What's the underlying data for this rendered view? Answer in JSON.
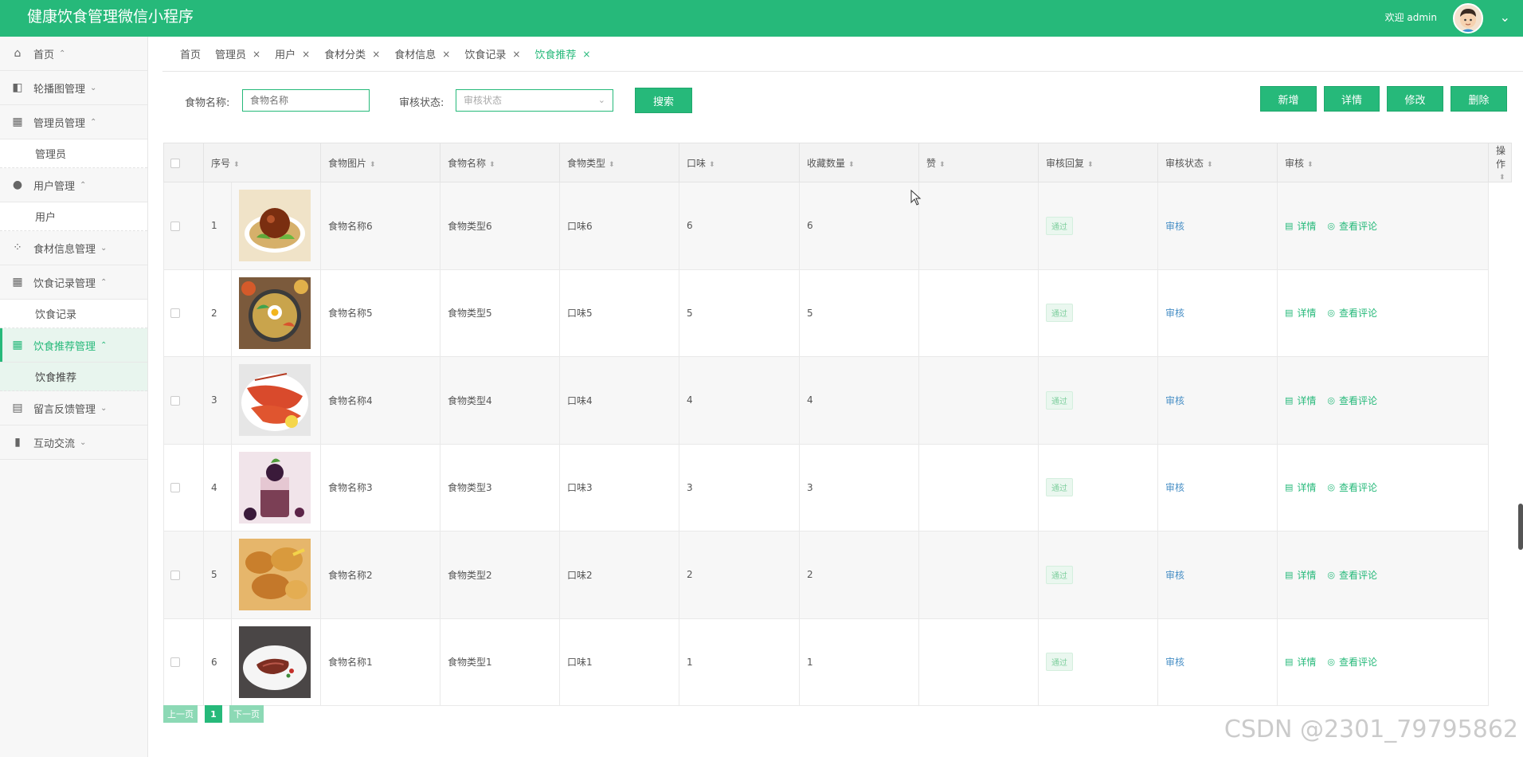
{
  "app": {
    "title": "健康饮食管理微信小程序",
    "welcome": "欢迎 admin",
    "accent": "#26b97a"
  },
  "sidebar": {
    "items": [
      {
        "label": "首页",
        "icon": "home-icon",
        "glyph": "⌂",
        "arrow": "⌃",
        "sub": []
      },
      {
        "label": "轮播图管理",
        "icon": "carousel-icon",
        "glyph": "◧",
        "arrow": "⌄",
        "sub": []
      },
      {
        "label": "管理员管理",
        "icon": "admin-icon",
        "glyph": "▦",
        "arrow": "⌃",
        "sub": [
          "管理员"
        ]
      },
      {
        "label": "用户管理",
        "icon": "user-icon",
        "glyph": "●",
        "arrow": "⌃",
        "sub": [
          "用户"
        ]
      },
      {
        "label": "食材信息管理",
        "icon": "ingredient-icon",
        "glyph": "⁘",
        "arrow": "⌄",
        "sub": []
      },
      {
        "label": "饮食记录管理",
        "icon": "record-icon",
        "glyph": "▦",
        "arrow": "⌃",
        "sub": [
          "饮食记录"
        ]
      },
      {
        "label": "饮食推荐管理",
        "icon": "recommend-icon",
        "glyph": "▦",
        "arrow": "⌃",
        "sub": [
          "饮食推荐"
        ],
        "active": true
      },
      {
        "label": "留言反馈管理",
        "icon": "feedback-icon",
        "glyph": "▤",
        "arrow": "⌄",
        "sub": []
      },
      {
        "label": "互动交流",
        "icon": "chat-icon",
        "glyph": "▮",
        "arrow": "⌄",
        "sub": []
      }
    ]
  },
  "tabs": [
    {
      "label": "首页",
      "closable": false
    },
    {
      "label": "管理员",
      "closable": true
    },
    {
      "label": "用户",
      "closable": true
    },
    {
      "label": "食材分类",
      "closable": true
    },
    {
      "label": "食材信息",
      "closable": true
    },
    {
      "label": "饮食记录",
      "closable": true
    },
    {
      "label": "饮食推荐",
      "closable": true,
      "active": true
    }
  ],
  "search": {
    "name_label": "食物名称:",
    "name_placeholder": "食物名称",
    "status_label": "审核状态:",
    "status_placeholder": "审核状态",
    "search_button": "搜索"
  },
  "actions": {
    "add": "新增",
    "detail": "详情",
    "edit": "修改",
    "delete": "删除"
  },
  "table": {
    "columns": [
      "序号",
      "食物图片",
      "食物名称",
      "食物类型",
      "口味",
      "收藏数量",
      "赞",
      "审核回复",
      "审核状态",
      "审核",
      "操作"
    ],
    "rows": [
      {
        "idx": "1",
        "name": "食物名称6",
        "type": "食物类型6",
        "taste": "口味6",
        "fav": "6",
        "like": "6",
        "reply": "",
        "status": "通过",
        "audit": "审核"
      },
      {
        "idx": "2",
        "name": "食物名称5",
        "type": "食物类型5",
        "taste": "口味5",
        "fav": "5",
        "like": "5",
        "reply": "",
        "status": "通过",
        "audit": "审核"
      },
      {
        "idx": "3",
        "name": "食物名称4",
        "type": "食物类型4",
        "taste": "口味4",
        "fav": "4",
        "like": "4",
        "reply": "",
        "status": "通过",
        "audit": "审核"
      },
      {
        "idx": "4",
        "name": "食物名称3",
        "type": "食物类型3",
        "taste": "口味3",
        "fav": "3",
        "like": "3",
        "reply": "",
        "status": "通过",
        "audit": "审核"
      },
      {
        "idx": "5",
        "name": "食物名称2",
        "type": "食物类型2",
        "taste": "口味2",
        "fav": "2",
        "like": "2",
        "reply": "",
        "status": "通过",
        "audit": "审核"
      },
      {
        "idx": "6",
        "name": "食物名称1",
        "type": "食物类型1",
        "taste": "口味1",
        "fav": "1",
        "like": "1",
        "reply": "",
        "status": "通过",
        "audit": "审核"
      }
    ],
    "row_ops": {
      "detail": "详情",
      "comments": "查看评论"
    }
  },
  "pager": {
    "prev": "上一页",
    "current": "1",
    "next": "下一页"
  },
  "watermark": "CSDN @2301_79795862"
}
